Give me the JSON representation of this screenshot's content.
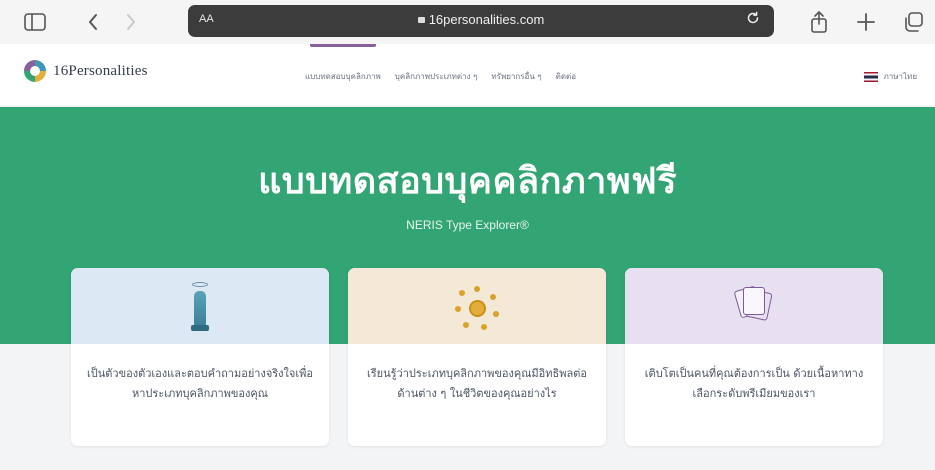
{
  "browser": {
    "text_size_label": "AA",
    "url": "16personalities.com",
    "toolbar_icons": [
      "sidebar-icon",
      "chevron-left-icon",
      "chevron-right-icon",
      "reload-icon",
      "share-icon",
      "plus-icon",
      "tabs-icon"
    ]
  },
  "site_nav": {
    "logo_text": "16Personalities",
    "links": [
      "แบบทดสอบบุคลิกภาพ",
      "บุคลิกภาพประเภทต่าง ๆ",
      "ทรัพยากรอื่น ๆ",
      "ติดต่อ"
    ],
    "language": "ภาษาไทย",
    "accent_color": "#88619a"
  },
  "hero": {
    "title": "แบบทดสอบบุคคลิกภาพฟรี",
    "subtitle": "NERIS Type Explorer®",
    "background_color": "#33a474"
  },
  "cards": [
    {
      "icon": "statue-icon",
      "text": "เป็นตัวของตัวเองและตอบคำถามอย่างจริงใจเพื่อหาประเภทบุคลิกภาพของคุณ"
    },
    {
      "icon": "burst-icon",
      "text": "เรียนรู้ว่าประเภทบุคลิกภาพของคุณมีอิทธิพลต่อด้านต่าง ๆ ในชีวิตของคุณอย่างไร"
    },
    {
      "icon": "cards-icon",
      "text": "เติบโตเป็นคนที่คุณต้องการเป็น ด้วยเนื้อหาทางเลือกระดับพรีเมียมของเรา"
    }
  ]
}
